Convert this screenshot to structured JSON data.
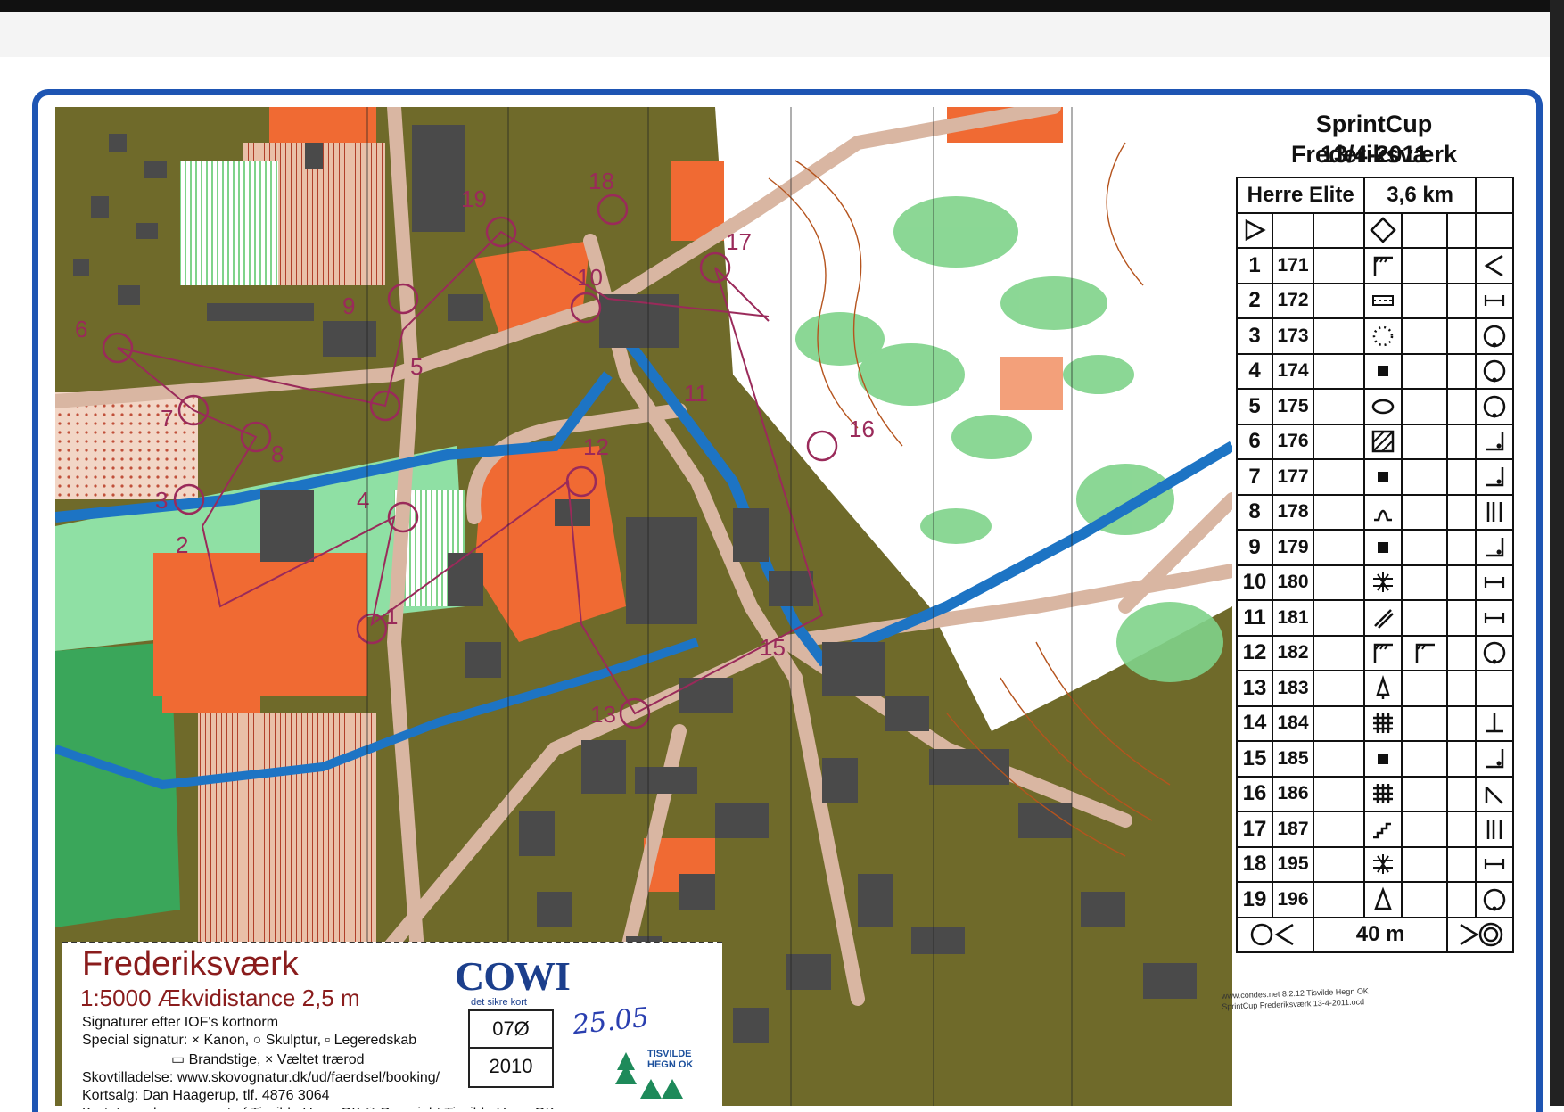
{
  "map": {
    "title": "Frederiksværk",
    "scale_line": "1:5000  Ækvidistance 2,5 m",
    "legend_lines": [
      "Signaturer efter IOF's kortnorm",
      "Special signatur:  × Kanon,  ○ Skulptur,  ▫ Legeredskab",
      "▭ Brandstige,  × Væltet trærod",
      "Skovtilladelse:  www.skovognatur.dk/ud/faerdsel/booking/",
      "Kortsalg: Dan Haagerup, tlf. 4876 3064",
      "Kortet er rekognosceret af Tisvilde Hegn OK       © Copyright Tisvilde Hegn OK"
    ],
    "publisher": "COWI",
    "publisher_tagline": "det sikre kort",
    "map_number": "07Ø",
    "map_year": "2010",
    "handwritten_note": "25.05",
    "club_logo_text": "TISVILDE HEGN OK",
    "control_labels": [
      "1",
      "2",
      "3",
      "4",
      "5",
      "6",
      "7",
      "8",
      "9",
      "10",
      "11",
      "12",
      "13",
      "15",
      "16",
      "17",
      "18",
      "19"
    ]
  },
  "control_description": {
    "event": "SprintCup Frederiksværk",
    "date": "13/4-2011",
    "class": "Herre Elite",
    "distance": "3,6 km",
    "controls": [
      {
        "n": "1",
        "code": "171",
        "symbol": "cliff",
        "extra": "",
        "pos": "corner-v"
      },
      {
        "n": "2",
        "code": "172",
        "symbol": "wall",
        "extra": "",
        "pos": "end"
      },
      {
        "n": "3",
        "code": "173",
        "symbol": "dotted-circle",
        "extra": "",
        "pos": "circle-dot"
      },
      {
        "n": "4",
        "code": "174",
        "symbol": "square",
        "extra": "",
        "pos": "circle-dot"
      },
      {
        "n": "5",
        "code": "175",
        "symbol": "ellipse",
        "extra": "",
        "pos": "circle-dot"
      },
      {
        "n": "6",
        "code": "176",
        "symbol": "hatched-square",
        "extra": "",
        "pos": "corner"
      },
      {
        "n": "7",
        "code": "177",
        "symbol": "square",
        "extra": "",
        "pos": "corner"
      },
      {
        "n": "8",
        "code": "178",
        "symbol": "passage",
        "extra": "",
        "pos": "between"
      },
      {
        "n": "9",
        "code": "179",
        "symbol": "square",
        "extra": "",
        "pos": "corner"
      },
      {
        "n": "10",
        "code": "180",
        "symbol": "cross",
        "extra": "",
        "pos": "end"
      },
      {
        "n": "11",
        "code": "181",
        "symbol": "bridge",
        "extra": "",
        "pos": "end"
      },
      {
        "n": "12",
        "code": "182",
        "symbol": "cliff",
        "extra": "cliff-fork",
        "pos": "circle-dot"
      },
      {
        "n": "13",
        "code": "183",
        "symbol": "monument",
        "extra": "",
        "pos": "none"
      },
      {
        "n": "14",
        "code": "184",
        "symbol": "grid",
        "extra": "",
        "pos": "foot"
      },
      {
        "n": "15",
        "code": "185",
        "symbol": "square",
        "extra": "",
        "pos": "corner"
      },
      {
        "n": "16",
        "code": "186",
        "symbol": "grid",
        "extra": "",
        "pos": "slash"
      },
      {
        "n": "17",
        "code": "187",
        "symbol": "stairs",
        "extra": "",
        "pos": "between"
      },
      {
        "n": "18",
        "code": "195",
        "symbol": "cross",
        "extra": "",
        "pos": "end"
      },
      {
        "n": "19",
        "code": "196",
        "symbol": "pylon",
        "extra": "",
        "pos": "circle-dot"
      }
    ],
    "finish_distance": "40 m",
    "credit_line_1": "www.condes.net 8.2.12 Tisvilde Hegn OK",
    "credit_line_2": "SprintCup Frederiksværk 13-4-2011.ocd"
  },
  "colors": {
    "frame": "#1e55b3",
    "course": "#9a2a5a",
    "water": "#1d74c4",
    "building": "#4a4a4a",
    "open": "#f06a33",
    "olive": "#6f6a2a",
    "forest_green": "#7fd38a",
    "paved": "#e7c9b6"
  }
}
